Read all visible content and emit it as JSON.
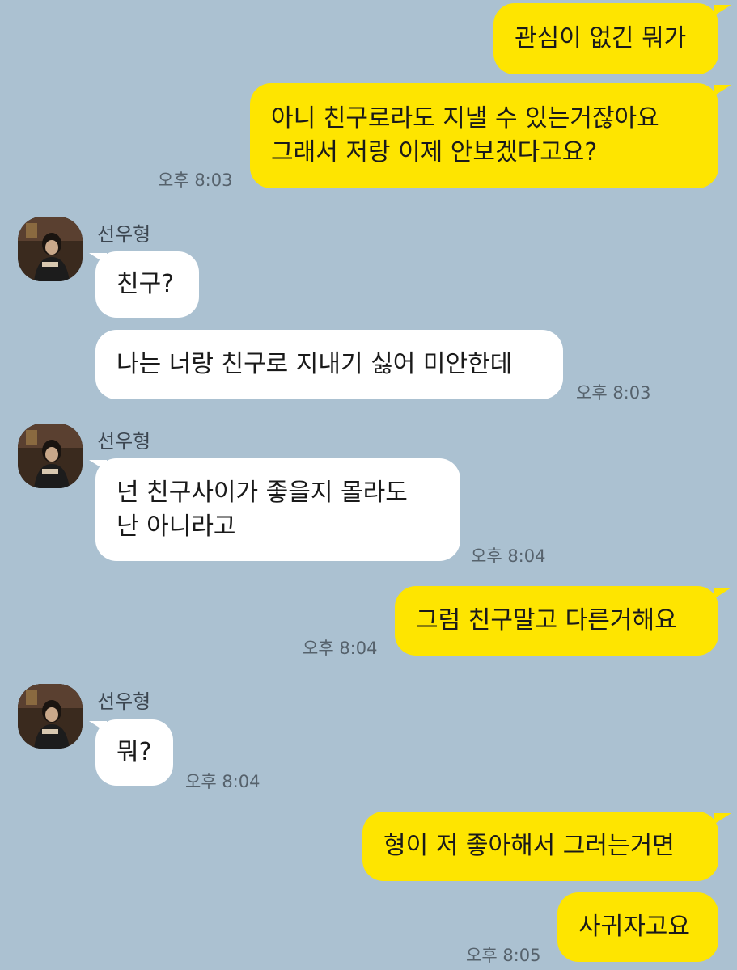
{
  "contact": {
    "name": "선우형"
  },
  "messages": [
    {
      "from": "me",
      "lines": [
        "관심이 없긴 뭐가"
      ]
    },
    {
      "from": "me",
      "lines": [
        "아니 친구로라도 지낼 수 있는거잖아요",
        "그래서 저랑 이제 안보겠다고요?"
      ],
      "time": "오후 8:03"
    },
    {
      "from": "other",
      "lines": [
        "친구?"
      ]
    },
    {
      "from": "other",
      "lines": [
        "나는 너랑 친구로 지내기 싫어 미안한데"
      ],
      "time": "오후 8:03"
    },
    {
      "from": "other",
      "lines": [
        "넌 친구사이가 좋을지 몰라도",
        "난 아니라고"
      ],
      "time": "오후 8:04"
    },
    {
      "from": "me",
      "lines": [
        "그럼 친구말고 다른거해요"
      ],
      "time": "오후 8:04"
    },
    {
      "from": "other",
      "lines": [
        "뭐?"
      ],
      "time": "오후 8:04"
    },
    {
      "from": "me",
      "lines": [
        "형이 저 좋아해서 그러는거면"
      ]
    },
    {
      "from": "me",
      "lines": [
        "사귀자고요"
      ],
      "time": "오후 8:05"
    }
  ],
  "colors": {
    "background": "#abc1d1",
    "my_bubble": "#fee500",
    "their_bubble": "#ffffff"
  }
}
